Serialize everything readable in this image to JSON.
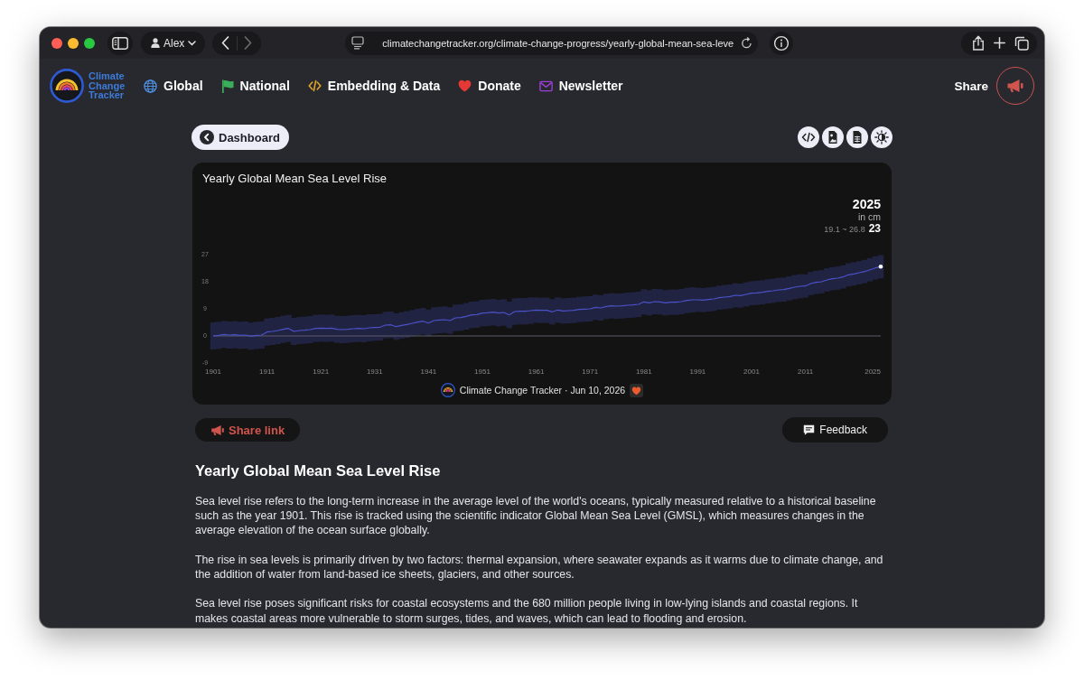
{
  "browser": {
    "profile": "Alex",
    "nav_buttons": [
      {
        "kind": "back",
        "disabled": false
      },
      {
        "kind": "forward",
        "disabled": true
      }
    ],
    "url": "climatechangetracker.org/climate-change-progress/yearly-global-mean-sea-leve"
  },
  "site_nav": {
    "logo_text": "Climate Change Tracker",
    "items": [
      {
        "kind": "globe",
        "label": "Global"
      },
      {
        "kind": "flag",
        "label": "National"
      },
      {
        "kind": "code",
        "label": "Embedding & Data"
      },
      {
        "kind": "heart",
        "label": "Donate"
      },
      {
        "kind": "envelope",
        "label": "Newsletter"
      }
    ],
    "share_label": "Share"
  },
  "toolbar": {
    "back_button": "Dashboard",
    "actions": [
      {
        "kind": "code"
      },
      {
        "kind": "image"
      },
      {
        "kind": "table"
      },
      {
        "kind": "theme"
      }
    ]
  },
  "chart_card": {
    "readout": {
      "year": "2025",
      "unit": "in cm",
      "range": "19.1 ~ 26.8",
      "value": "23"
    },
    "chart_data": {
      "type": "line",
      "title": "Yearly Global Mean Sea Level Rise",
      "color": "#4b52c8",
      "x": [
        1901,
        1902,
        1903,
        1904,
        1905,
        1906,
        1907,
        1908,
        1909,
        1910,
        1911,
        1912,
        1913,
        1914,
        1915,
        1916,
        1917,
        1918,
        1919,
        1920,
        1921,
        1922,
        1923,
        1924,
        1925,
        1926,
        1927,
        1928,
        1929,
        1930,
        1931,
        1932,
        1933,
        1934,
        1935,
        1936,
        1937,
        1938,
        1939,
        1940,
        1941,
        1942,
        1943,
        1944,
        1945,
        1946,
        1947,
        1948,
        1949,
        1950,
        1951,
        1952,
        1953,
        1954,
        1955,
        1956,
        1957,
        1958,
        1959,
        1960,
        1961,
        1962,
        1963,
        1964,
        1965,
        1966,
        1967,
        1968,
        1969,
        1970,
        1971,
        1972,
        1973,
        1974,
        1975,
        1976,
        1977,
        1978,
        1979,
        1980,
        1981,
        1982,
        1983,
        1984,
        1985,
        1986,
        1987,
        1988,
        1989,
        1990,
        1991,
        1992,
        1993,
        1994,
        1995,
        1996,
        1997,
        1998,
        1999,
        2000,
        2001,
        2002,
        2003,
        2004,
        2005,
        2006,
        2007,
        2008,
        2009,
        2010,
        2011,
        2012,
        2013,
        2014,
        2015,
        2016,
        2017,
        2018,
        2019,
        2020,
        2021,
        2022,
        2023,
        2024,
        2025
      ],
      "values": [
        0,
        0.2,
        0.5,
        0.3,
        0.4,
        0.2,
        0.3,
        -0.1,
        0.2,
        0.3,
        1.3,
        1.5,
        1.8,
        2.2,
        2.5,
        1.5,
        1.8,
        1.9,
        2.1,
        2.5,
        2.6,
        2.5,
        2.6,
        2.2,
        2.1,
        2.2,
        2.4,
        2.5,
        2.4,
        2.7,
        2.8,
        2.9,
        3.6,
        3.7,
        3.1,
        3.5,
        3.8,
        4.2,
        4.6,
        4.9,
        4.3,
        5.1,
        5.3,
        5.4,
        5.1,
        6.0,
        6.1,
        6.5,
        7.0,
        7.1,
        7.6,
        7.7,
        7.9,
        7.6,
        7.8,
        7.0,
        8.1,
        8.2,
        8.2,
        8.4,
        8.6,
        8.5,
        8.5,
        8.0,
        8.6,
        8.3,
        8.4,
        8.5,
        8.8,
        8.9,
        9.0,
        9.5,
        9.3,
        9.8,
        10.0,
        9.9,
        10.0,
        10.2,
        10.3,
        10.5,
        11.3,
        11.0,
        11.4,
        11.3,
        11.0,
        11.2,
        11.2,
        11.4,
        11.8,
        12.0,
        12.0,
        11.9,
        12.1,
        12.3,
        12.7,
        12.9,
        13.1,
        13.5,
        13.4,
        13.8,
        14.2,
        14.3,
        14.5,
        14.8,
        15.0,
        15.3,
        15.4,
        15.8,
        16.2,
        16.5,
        16.6,
        17.4,
        17.8,
        18.0,
        18.6,
        19.0,
        19.2,
        19.6,
        20.3,
        20.6,
        21.0,
        21.4,
        22.0,
        22.6,
        23.0
      ],
      "errors": [
        4.5,
        4.5,
        4.5,
        4.5,
        4.5,
        4.5,
        4.5,
        4.5,
        4.5,
        4.5,
        4.5,
        4.5,
        4.5,
        4.5,
        4.5,
        4.5,
        4.5,
        4.5,
        4.5,
        4.5,
        4.5,
        4.5,
        4.5,
        4.5,
        4.5,
        4.5,
        4.5,
        4.5,
        4.5,
        4.5,
        4.4,
        4.4,
        4.4,
        4.4,
        4.4,
        4.4,
        4.4,
        4.4,
        4.4,
        4.4,
        4.4,
        4.4,
        4.4,
        4.4,
        4.4,
        4.4,
        4.4,
        4.4,
        4.4,
        4.4,
        4.4,
        4.4,
        4.4,
        4.4,
        4.4,
        4.4,
        4.4,
        4.4,
        4.4,
        4.4,
        4.2,
        4.2,
        4.2,
        4.2,
        4.2,
        4.2,
        4.2,
        4.2,
        4.2,
        4.2,
        4.2,
        4.2,
        4.2,
        4.2,
        4.2,
        4.2,
        4.2,
        4.2,
        4.2,
        4.2,
        4.2,
        4.2,
        4.2,
        4.2,
        4.2,
        4.2,
        4.2,
        4.2,
        4.2,
        4.2,
        4,
        4,
        4,
        4,
        4,
        4,
        4,
        4,
        4,
        4,
        4,
        4,
        4,
        4,
        4,
        4,
        4,
        4,
        4,
        4,
        3.85,
        3.85,
        3.85,
        3.85,
        3.85,
        3.85,
        3.85,
        3.85,
        3.85,
        3.85,
        3.85,
        3.85,
        3.85,
        3.85,
        3.85
      ],
      "xlim": [
        1901,
        2025
      ],
      "ylim": [
        -9,
        27
      ],
      "xticks": [
        1901,
        1911,
        1921,
        1931,
        1941,
        1951,
        1961,
        1971,
        1981,
        1991,
        2001,
        2011,
        2025
      ],
      "yticks": [
        -9,
        0,
        9,
        18,
        27
      ],
      "ref_lines": [
        {
          "axis": "y",
          "value": 0,
          "color": "#5c5c66"
        }
      ]
    },
    "credit": "Climate Change Tracker · Jun 10, 2026"
  },
  "actions": {
    "share_link": "Share link",
    "feedback": "Feedback"
  },
  "article": {
    "heading": "Yearly Global Mean Sea Level Rise",
    "paragraphs": [
      "Sea level rise refers to the long-term increase in the average level of the world's oceans, typically measured relative to a historical baseline such as the year 1901. This rise is tracked using the scientific indicator Global Mean Sea Level (GMSL), which measures changes in the average elevation of the ocean surface globally.",
      "The rise in sea levels is primarily driven by two factors: thermal expansion, where seawater expands as it warms due to climate change, and the addition of water from land-based ice sheets, glaciers, and other sources.",
      "Sea level rise poses significant risks for coastal ecosystems and the 680 million people living in low-lying islands and coastal regions. It makes coastal areas more vulnerable to storm surges, tides, and waves, which can lead to flooding and erosion."
    ]
  }
}
